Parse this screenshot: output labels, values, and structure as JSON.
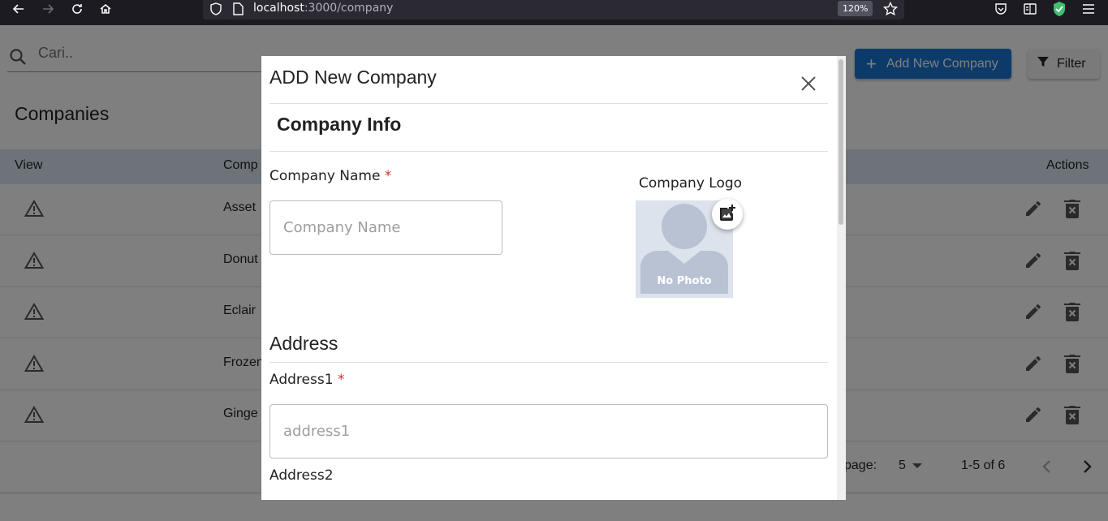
{
  "browser": {
    "url_host": "localhost",
    "url_path": ":3000/company",
    "zoom": "120%"
  },
  "app": {
    "search": {
      "placeholder": "Cari.."
    },
    "add_button": "Add New Company",
    "filter_button": "Filter",
    "page_title": "Companies",
    "table": {
      "headers": {
        "view": "View",
        "company": "Comp",
        "actions": "Actions"
      },
      "rows": [
        {
          "name": "Asset"
        },
        {
          "name": "Donut"
        },
        {
          "name": "Eclair"
        },
        {
          "name": "Frozen"
        },
        {
          "name": "Ginge"
        }
      ]
    },
    "pagination": {
      "rows_label": "page:",
      "rows_per_page": "5",
      "range": "1-5 of 6"
    }
  },
  "modal": {
    "title": "ADD New Company",
    "section_title": "Company Info",
    "company_name": {
      "label": "Company Name",
      "required_mark": "*",
      "placeholder": "Company Name",
      "value": ""
    },
    "company_logo": {
      "label": "Company Logo",
      "caption": "No Photo"
    },
    "address_title": "Address",
    "address1": {
      "label": "Address1",
      "required_mark": "*",
      "placeholder": "address1",
      "value": ""
    },
    "address2": {
      "label": "Address2"
    }
  },
  "colors": {
    "primary": "#1976d2",
    "table_header": "#dbe7f3",
    "required": "#d32f2f",
    "overlay": "rgba(0,0,0,0.5)"
  }
}
